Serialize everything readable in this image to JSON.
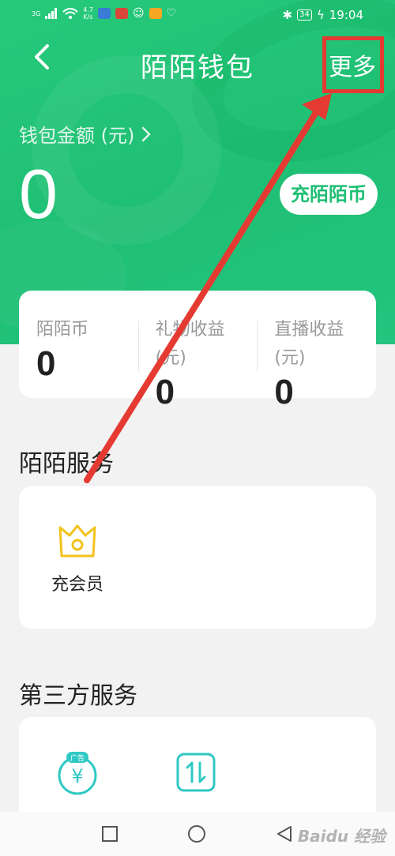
{
  "status_bar": {
    "network": "3G",
    "speed_value": "4.7",
    "speed_unit": "K/s",
    "battery": "34",
    "time": "19:04"
  },
  "header": {
    "title": "陌陌钱包",
    "more_label": "更多"
  },
  "wallet": {
    "label": "钱包金额 (元)",
    "amount": "0",
    "recharge_button": "充陌陌币"
  },
  "stats": [
    {
      "label_line1": "陌陌币",
      "label_line2": "",
      "value": "0"
    },
    {
      "label_line1": "礼物收益",
      "label_line2": "(元)",
      "value": "0"
    },
    {
      "label_line1": "直播收益",
      "label_line2": "(元)",
      "value": "0"
    }
  ],
  "momo_services": {
    "title": "陌陌服务",
    "items": [
      {
        "label": "充会员",
        "icon": "crown-icon"
      }
    ]
  },
  "third_party": {
    "title": "第三方服务",
    "items": [
      {
        "badge": "广告",
        "symbol": "¥",
        "icon": "yuan-ad-icon"
      },
      {
        "icon": "transfer-arrows-icon"
      }
    ]
  },
  "watermark": "Baidu 经验",
  "colors": {
    "brand_green": "#1fbf74",
    "annotation_red": "#e53a32",
    "crown_yellow": "#f2c21b",
    "cyan_icon": "#2fc9c4"
  }
}
